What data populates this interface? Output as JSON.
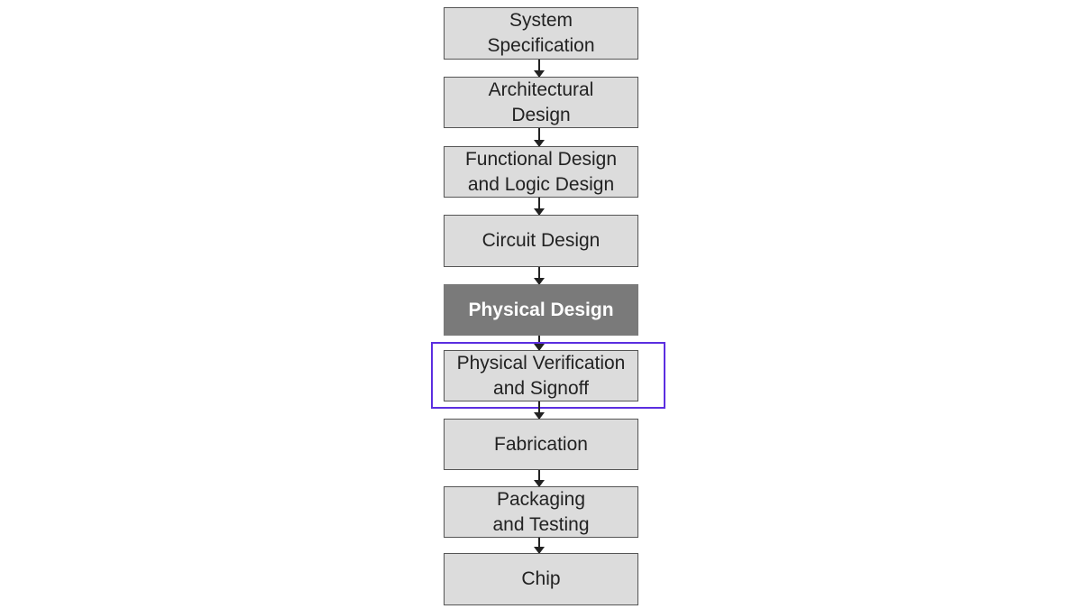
{
  "flow": {
    "steps": [
      {
        "label": "System\nSpecification"
      },
      {
        "label": "Architectural\nDesign"
      },
      {
        "label": "Functional Design\nand Logic Design"
      },
      {
        "label": "Circuit Design"
      },
      {
        "label": "Physical Design",
        "emphasis": "dark"
      },
      {
        "label": "Physical Verification\nand Signoff",
        "highlighted": true
      },
      {
        "label": "Fabrication"
      },
      {
        "label": "Packaging\nand Testing"
      },
      {
        "label": "Chip"
      }
    ],
    "highlight_color": "#5b2ee0",
    "box_color": "#dcdcdc",
    "dark_box_color": "#7a7a7a"
  }
}
